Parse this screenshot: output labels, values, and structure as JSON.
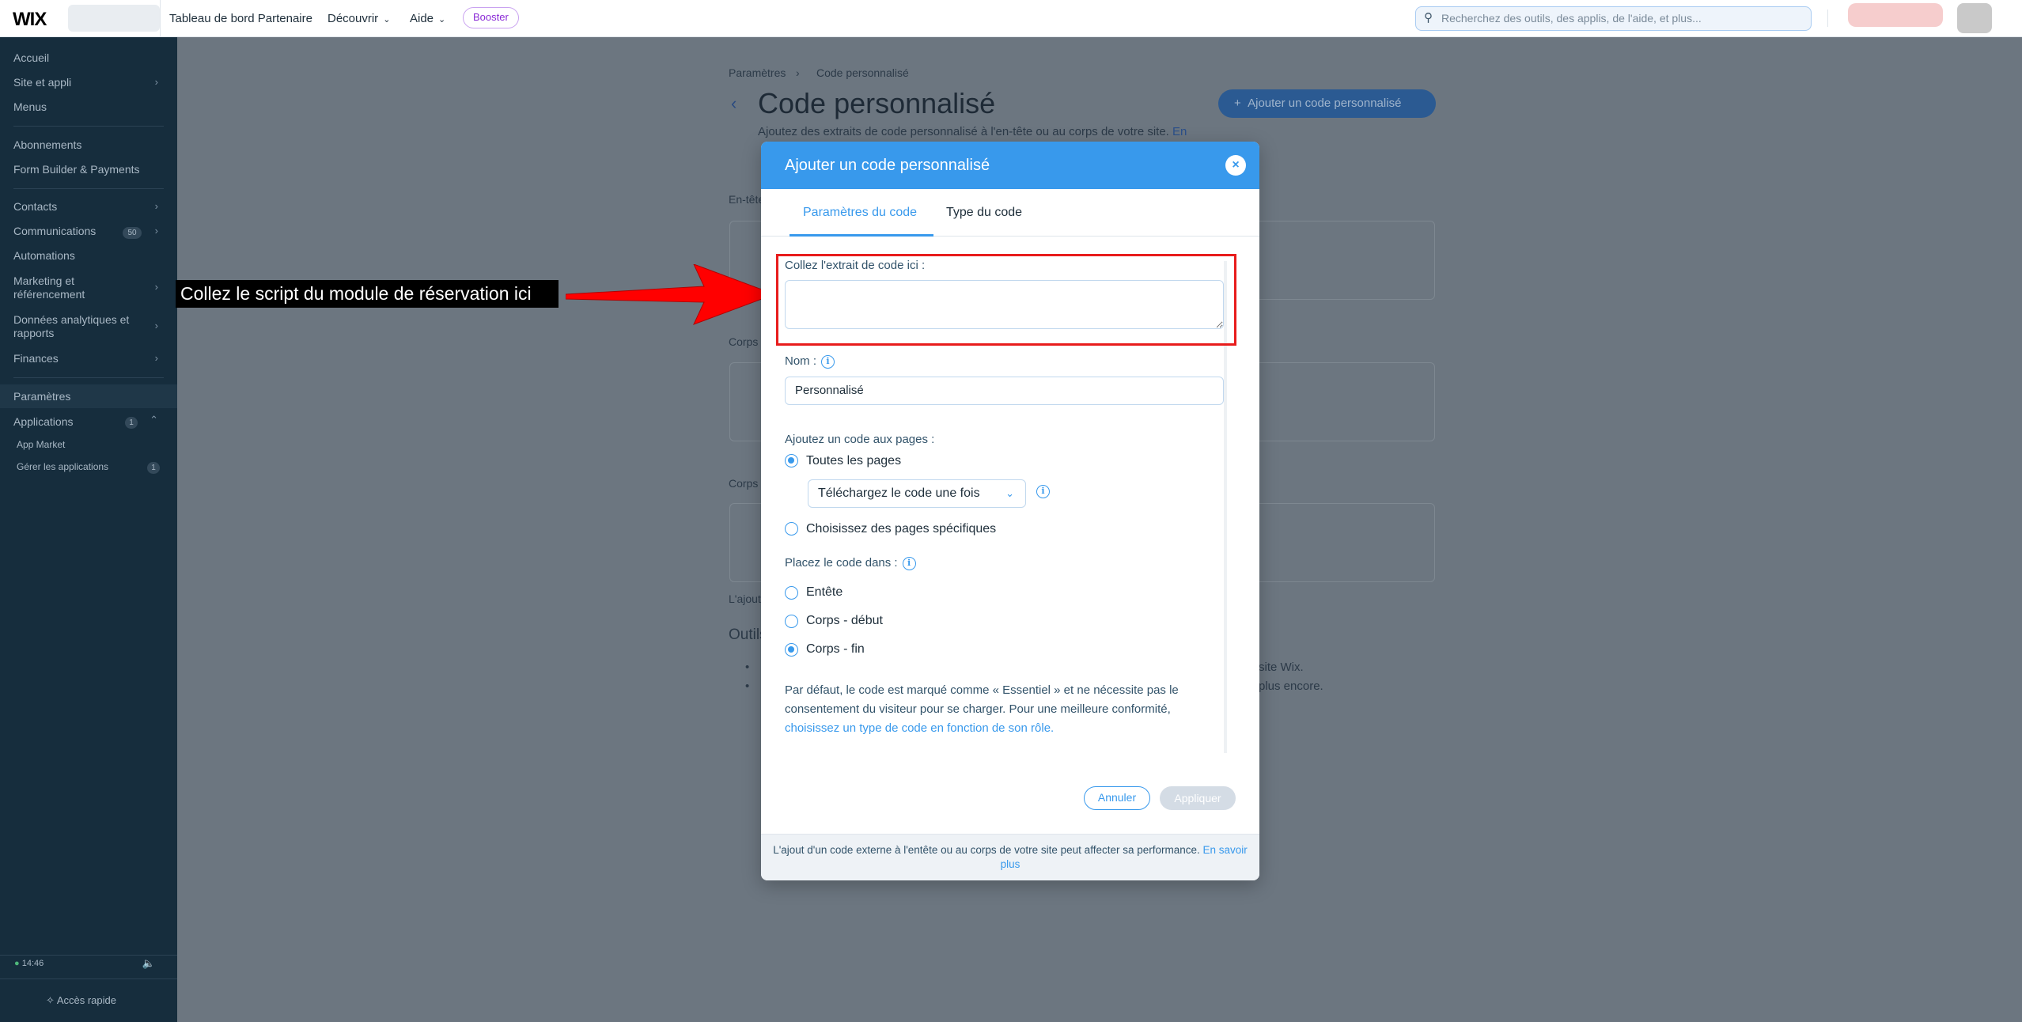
{
  "topbar": {
    "logo": "WIX",
    "nav": [
      "Tableau de bord Partenaire",
      "Découvrir",
      "Aide"
    ],
    "booster": "Booster",
    "search_placeholder": "Recherchez des outils, des applis, de l'aide, et plus..."
  },
  "sidebar": {
    "items": [
      {
        "label": "Accueil"
      },
      {
        "label": "Site et appli"
      },
      {
        "label": "Menus"
      },
      {
        "label": "Abonnements"
      },
      {
        "label": "Form Builder & Payments"
      },
      {
        "label": "Contacts"
      },
      {
        "label": "Communications",
        "badge": "50"
      },
      {
        "label": "Automations"
      },
      {
        "label": "Marketing et référencement"
      },
      {
        "label": "Données analytiques et rapports"
      },
      {
        "label": "Finances"
      },
      {
        "label": "Paramètres"
      },
      {
        "label": "Applications",
        "badge": "1"
      },
      {
        "label": "App Market"
      },
      {
        "label": "Gérer les applications",
        "badge": "1"
      }
    ],
    "time": "14:46",
    "quick_access": "Accès rapide"
  },
  "background": {
    "breadcrumb": [
      "Paramètres",
      "Code personnalisé"
    ],
    "title": "Code personnalisé",
    "subtitle": "Ajoutez des extraits de code personnalisé à l'en-tête ou au corps de votre site.",
    "subtitle_link": "En",
    "add_button": "Ajouter un code personnalisé",
    "section_labels": [
      "En-tête",
      "Corps",
      "Corps"
    ],
    "footnote": "L'ajout",
    "tools_title": "Outils",
    "tools_lines": [
      "site Wix.",
      "plus encore."
    ]
  },
  "annotation": {
    "text": "Collez le script du module de réservation ici",
    "arrow_color": "#ff0000"
  },
  "modal": {
    "title": "Ajouter un code personnalisé",
    "tabs": [
      "Paramètres du code",
      "Type du code"
    ],
    "code_label": "Collez l'extrait de code ici :",
    "name_label": "Nom :",
    "name_value": "Personnalisé",
    "pages_label": "Ajoutez un code aux pages :",
    "pages_options": [
      "Toutes les pages",
      "Choisissez des pages spécifiques"
    ],
    "pages_selected": "Toutes les pages",
    "load_select": "Téléchargez le code une fois",
    "place_label": "Placez le code dans :",
    "place_options": [
      "Entête",
      "Corps - début",
      "Corps - fin"
    ],
    "place_selected": "Corps - fin",
    "note_text": "Par défaut, le code est marqué comme « Essentiel » et ne nécessite pas le consentement du visiteur pour se charger. Pour une meilleure conformité,",
    "note_link": "choisissez un type de code en fonction de son rôle.",
    "cancel": "Annuler",
    "apply": "Appliquer",
    "footer_text": "L'ajout d'un code externe à l'entête ou au corps de votre site peut affecter sa performance.",
    "footer_link": "En savoir plus"
  },
  "colors": {
    "accent": "#3899ec",
    "sidebar": "#162d3d",
    "highlight": "#e81c1c"
  }
}
